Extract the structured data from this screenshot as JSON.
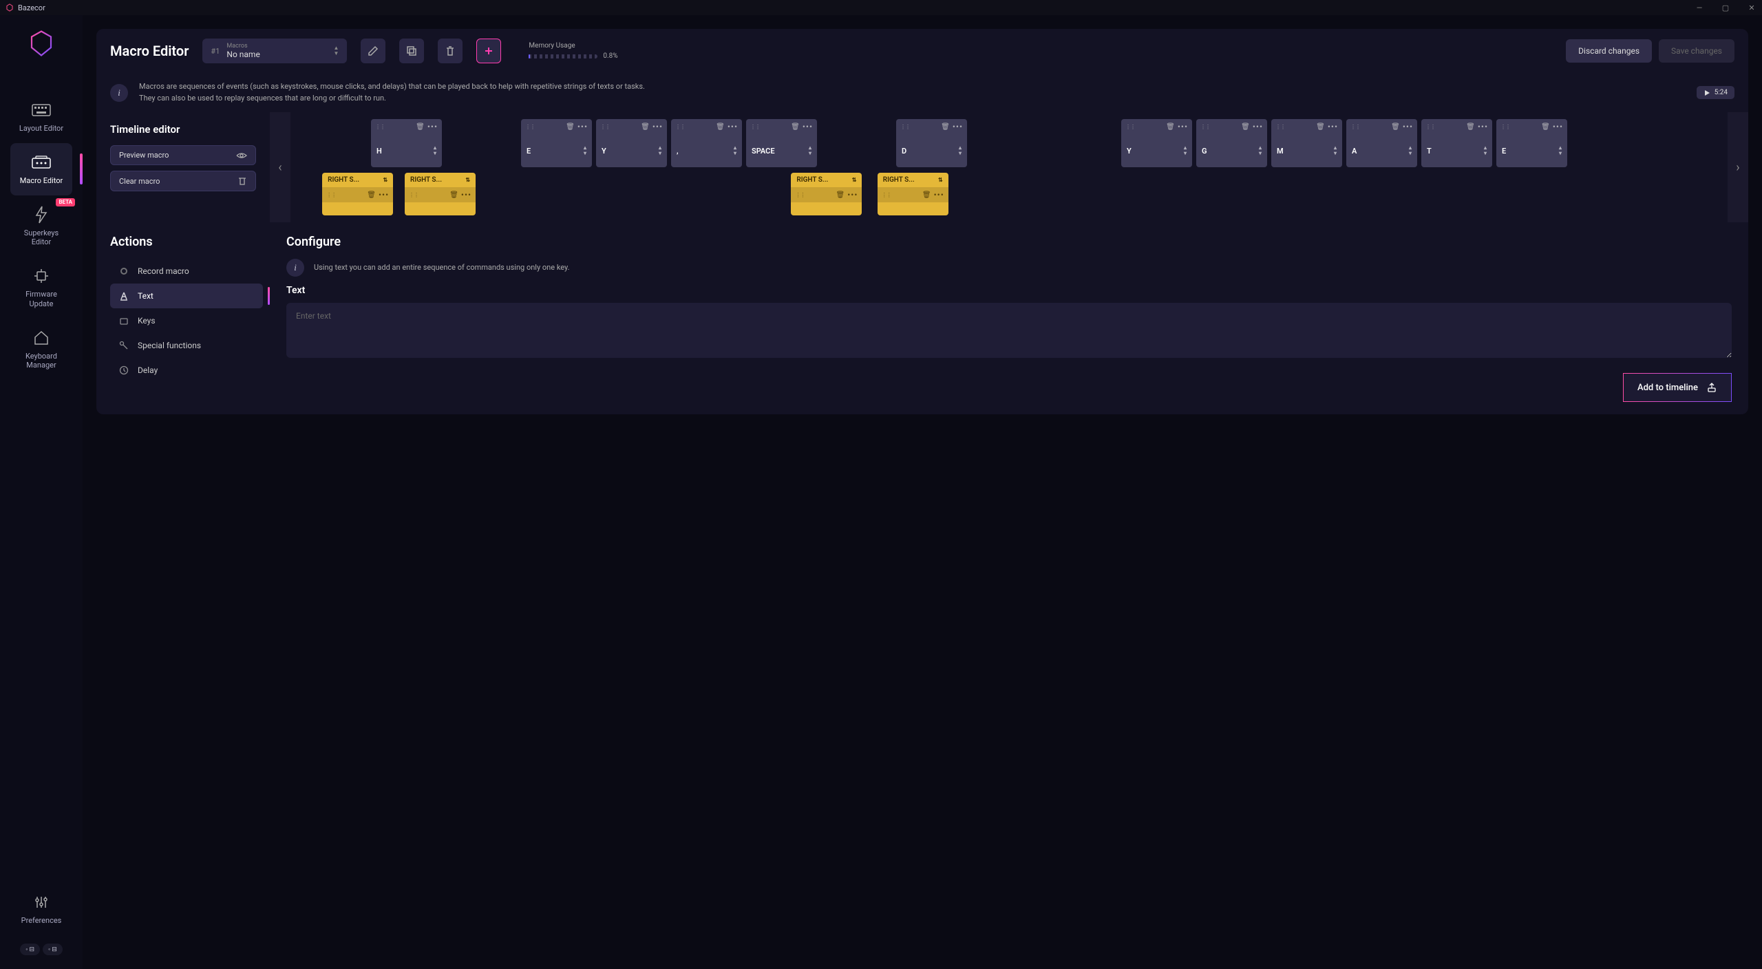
{
  "app": {
    "name": "Bazecor"
  },
  "sidebar": {
    "items": [
      {
        "label": "Layout Editor"
      },
      {
        "label": "Macro Editor"
      },
      {
        "label": "Superkeys Editor",
        "badge": "BETA"
      },
      {
        "label": "Firmware Update"
      },
      {
        "label": "Keyboard Manager"
      }
    ],
    "preferences": "Preferences"
  },
  "header": {
    "title": "Macro Editor",
    "macro_number": "#1",
    "macro_label": "Macros",
    "macro_name": "No name",
    "memory_label": "Memory Usage",
    "memory_pct": "0.8%",
    "discard": "Discard changes",
    "save": "Save changes"
  },
  "info": {
    "line1": "Macros are sequences of events (such as keystrokes, mouse clicks, and delays) that can be played back to help with repetitive strings of texts or tasks.",
    "line2": "They can also be used to replay sequences that are long or difficult to run.",
    "play_duration": "5:24"
  },
  "timeline": {
    "title": "Timeline editor",
    "preview": "Preview macro",
    "clear": "Clear macro",
    "row1": [
      "",
      "H",
      "",
      "E",
      "Y",
      ",",
      "SPACE",
      "",
      "D",
      "",
      "",
      "Y",
      "G",
      "M",
      "A",
      "T",
      "E"
    ],
    "row2_labels": {
      "shift": "RIGHT S..."
    },
    "row2_positions": [
      0,
      2,
      6.5,
      8.5
    ]
  },
  "actions": {
    "title": "Actions",
    "items": [
      {
        "label": "Record macro",
        "icon": "record"
      },
      {
        "label": "Text",
        "icon": "text"
      },
      {
        "label": "Keys",
        "icon": "key"
      },
      {
        "label": "Special functions",
        "icon": "fn"
      },
      {
        "label": "Delay",
        "icon": "clock"
      }
    ]
  },
  "configure": {
    "title": "Configure",
    "hint": "Using text you can add an entire sequence of commands using only one key.",
    "section": "Text",
    "placeholder": "Enter text",
    "add_button": "Add to timeline"
  }
}
